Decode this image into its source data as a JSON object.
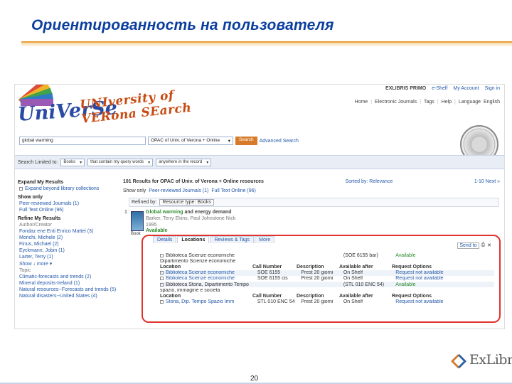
{
  "slide": {
    "title": "Ориентированность на пользователя",
    "page_number": "20",
    "footer_logo": "ExLibris"
  },
  "header": {
    "brand": "EXLIBRIS PRIMO",
    "eshelf": "e-Shelf",
    "my_account": "My Account",
    "sign_in": "Sign in",
    "nav": [
      "Home",
      "Electronic Journals",
      "Tags",
      "Help",
      "Language",
      "English"
    ],
    "logo_text_1": "UniVerSe",
    "logo_text_2": "UNIversity of VERona SEarch"
  },
  "search": {
    "query": "global warming",
    "scope": "OPAC of Univ. of Verona + Online",
    "button": "Search",
    "advanced": "Advanced Search"
  },
  "limits": {
    "label": "Search Limited to:",
    "material": "Books",
    "match": "that contain my query words",
    "field": "anywhere in the record"
  },
  "facets": {
    "expand_title": "Expand My Results",
    "expand_item": "Expand beyond library collections",
    "show_only_title": "Show only",
    "show_only_items": [
      "Peer-reviewed Journals (1)",
      "Full Text Online (96)"
    ],
    "refine_title": "Refine My Results",
    "author_label": "Author/Creator",
    "authors": [
      "Fondaz ene Enti Enrico Mattei (3)",
      "Morichi, Michele (2)",
      "Finus, Michael (2)",
      "Eyckmann, Jobin (1)",
      "Larter, Terry (1)"
    ],
    "show_more": "Show ↓ more ▾",
    "topic_label": "Topic",
    "topics": [
      "Climatic-forecasts and trends (2)",
      "Mineral deposits-Ireland (1)",
      "Natural resources--Forecasts and trends (5)",
      "Natural disasters--United States (4)"
    ]
  },
  "results": {
    "count_text": "101 Results for OPAC of Univ. of Verona + Online resources",
    "sorted_by": "Sorted by: Relevance",
    "paging": "1-10 Next »",
    "show_only_label": "Show only",
    "show_only_peer": "Peer-reviewed Journals (1)",
    "show_only_full": "Full Text Online (96)",
    "refined_by_label": "Refined by:",
    "refined_tag": "Resource type: Books",
    "record": {
      "index": "1",
      "title_highlight": "Global warming",
      "title_rest": " and energy demand",
      "authors": "Barker, Terry Ekins, Paul Johnstone Nick",
      "year": "1995",
      "availability": "Available",
      "type": "Book"
    },
    "tabs": [
      "Details",
      "Locations",
      "Reviews & Tags",
      "More"
    ],
    "send_to": "Send to"
  },
  "locations": {
    "rows": [
      {
        "c1": "Biblioteca Scienze economiche",
        "c2": "",
        "c3": "",
        "c4": "(SOE 6155 bar)",
        "c5": "Available",
        "kind": "lib"
      },
      {
        "c1": "Dipartimento Scienze economiche",
        "c2": "",
        "c3": "",
        "c4": "",
        "c5": "",
        "kind": "lib2"
      },
      {
        "c1": "Location",
        "c2": "Call Number",
        "c3": "Description",
        "c4": "Available after",
        "c5": "Request Options",
        "kind": "hdr"
      },
      {
        "c1": "Biblioteca Scienze economiche",
        "c2": "SOE 6155",
        "c3": "Prest 20 giorni",
        "c4": "On Shelf",
        "c5": "Request not available",
        "kind": "item"
      },
      {
        "c1": "Biblioteca Scienze economiche",
        "c2": "SOE 6155 cis",
        "c3": "Prest 20 giorni",
        "c4": "On Shelf",
        "c5": "Request not available",
        "kind": "item"
      },
      {
        "c1": "Biblioteca Storia, Dipartimento Tempo",
        "c2": "",
        "c3": "",
        "c4": "(STL 010 ENC 54)",
        "c5": "Available",
        "kind": "lib"
      },
      {
        "c1": "spazio, immagine e societa",
        "c2": "",
        "c3": "",
        "c4": "",
        "c5": "",
        "kind": "lib2"
      },
      {
        "c1": "Location",
        "c2": "Call Number",
        "c3": "Description",
        "c4": "Available after",
        "c5": "Request Options",
        "kind": "hdr"
      },
      {
        "c1": "Storia, Dip. Tempo Spazio Imm",
        "c2": "STL 010 ENC 54",
        "c3": "Prest 20 giorni",
        "c4": "On Shelf",
        "c5": "Request not available",
        "kind": "item"
      }
    ]
  },
  "colors": {
    "title_blue": "#0b3f9e",
    "accent_gold": "#e9a23b",
    "highlight_red": "#e0332c",
    "available_green": "#2d8c2d"
  }
}
